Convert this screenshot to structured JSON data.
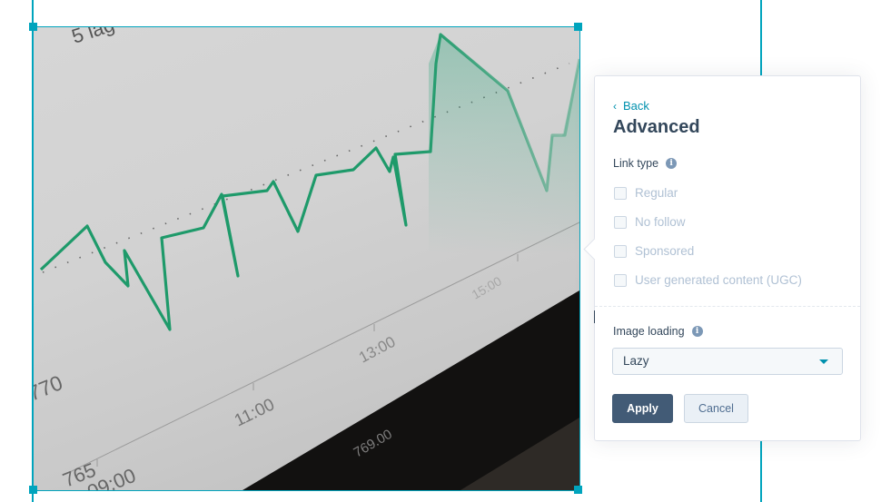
{
  "image": {
    "description": "photo of a stock price line chart on a laptop screen",
    "line_color": "#1e9a6a",
    "visible_text": {
      "top_label": "5 lag",
      "y_tick_770": "770",
      "y_tick_765": "765",
      "x_tick_0900": "09:00",
      "x_tick_1100": "11:00",
      "x_tick_1300": "13:00",
      "x_tick_1500": "15:00",
      "bottom_value": "769.00"
    }
  },
  "panel": {
    "back_label": "Back",
    "title": "Advanced",
    "link_type": {
      "label": "Link type",
      "info_icon": "info-icon",
      "options": [
        {
          "label": "Regular",
          "checked": false
        },
        {
          "label": "No follow",
          "checked": false
        },
        {
          "label": "Sponsored",
          "checked": false
        },
        {
          "label": "User generated content (UGC)",
          "checked": false
        }
      ]
    },
    "image_loading": {
      "label": "Image loading",
      "info_icon": "info-icon",
      "selected": "Lazy"
    },
    "apply_label": "Apply",
    "cancel_label": "Cancel"
  },
  "colors": {
    "accent": "#00a4bd",
    "link": "#0091ae",
    "primary_button": "#425b76",
    "text": "#33475b"
  }
}
